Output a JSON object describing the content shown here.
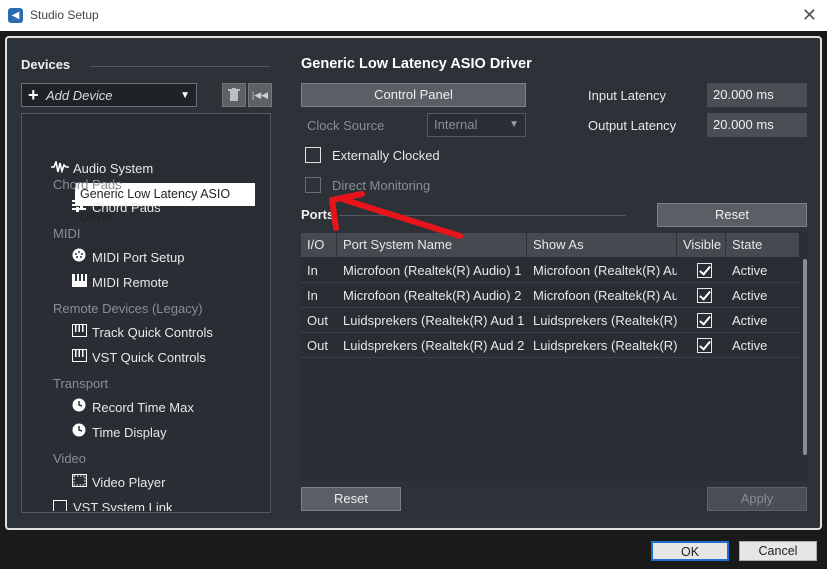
{
  "window": {
    "title": "Studio Setup",
    "close_glyph": "✕"
  },
  "devices": {
    "heading": "Devices",
    "add_device_label": "Add Device",
    "tree": {
      "audio_system": "Audio System",
      "selected_driver": "Generic Low Latency ASIO Driver",
      "cat_chord_pads": "Chord Pads",
      "chord_pads": "Chord Pads",
      "cat_midi": "MIDI",
      "midi_port_setup": "MIDI Port Setup",
      "midi_remote": "MIDI Remote",
      "cat_remote_devices": "Remote Devices (Legacy)",
      "track_quick_controls": "Track Quick Controls",
      "vst_quick_controls": "VST Quick Controls",
      "cat_transport": "Transport",
      "record_time_max": "Record Time Max",
      "time_display": "Time Display",
      "cat_video": "Video",
      "video_player": "Video Player",
      "vst_system_link": "VST System Link"
    }
  },
  "driver": {
    "title": "Generic Low Latency ASIO Driver",
    "control_panel_label": "Control Panel",
    "clock_source_label": "Clock Source",
    "clock_source_value": "Internal",
    "input_latency_label": "Input Latency",
    "input_latency_value": "20.000 ms",
    "output_latency_label": "Output Latency",
    "output_latency_value": "20.000 ms",
    "externally_clocked_label": "Externally Clocked",
    "direct_monitoring_label": "Direct Monitoring"
  },
  "ports": {
    "heading": "Ports",
    "reset_label": "Reset",
    "columns": [
      "I/O",
      "Port System Name",
      "Show As",
      "Visible",
      "State"
    ],
    "rows": [
      {
        "io": "In",
        "system_name": "Microfoon (Realtek(R) Audio) 1",
        "show_as": "Microfoon (Realtek(R) Au",
        "visible": true,
        "state": "Active"
      },
      {
        "io": "In",
        "system_name": "Microfoon (Realtek(R) Audio) 2",
        "show_as": "Microfoon (Realtek(R) Au",
        "visible": true,
        "state": "Active"
      },
      {
        "io": "Out",
        "system_name": "Luidsprekers (Realtek(R) Aud 1",
        "show_as": "Luidsprekers (Realtek(R) ⁄",
        "visible": true,
        "state": "Active"
      },
      {
        "io": "Out",
        "system_name": "Luidsprekers (Realtek(R) Aud 2",
        "show_as": "Luidsprekers (Realtek(R) ⁄",
        "visible": true,
        "state": "Active"
      }
    ]
  },
  "footer": {
    "reset_label": "Reset",
    "apply_label": "Apply",
    "ok_label": "OK",
    "cancel_label": "Cancel"
  },
  "colors": {
    "annotation": "#e8141c",
    "ok_border": "#1e6fd0",
    "panel_bg": "#2d3238"
  }
}
